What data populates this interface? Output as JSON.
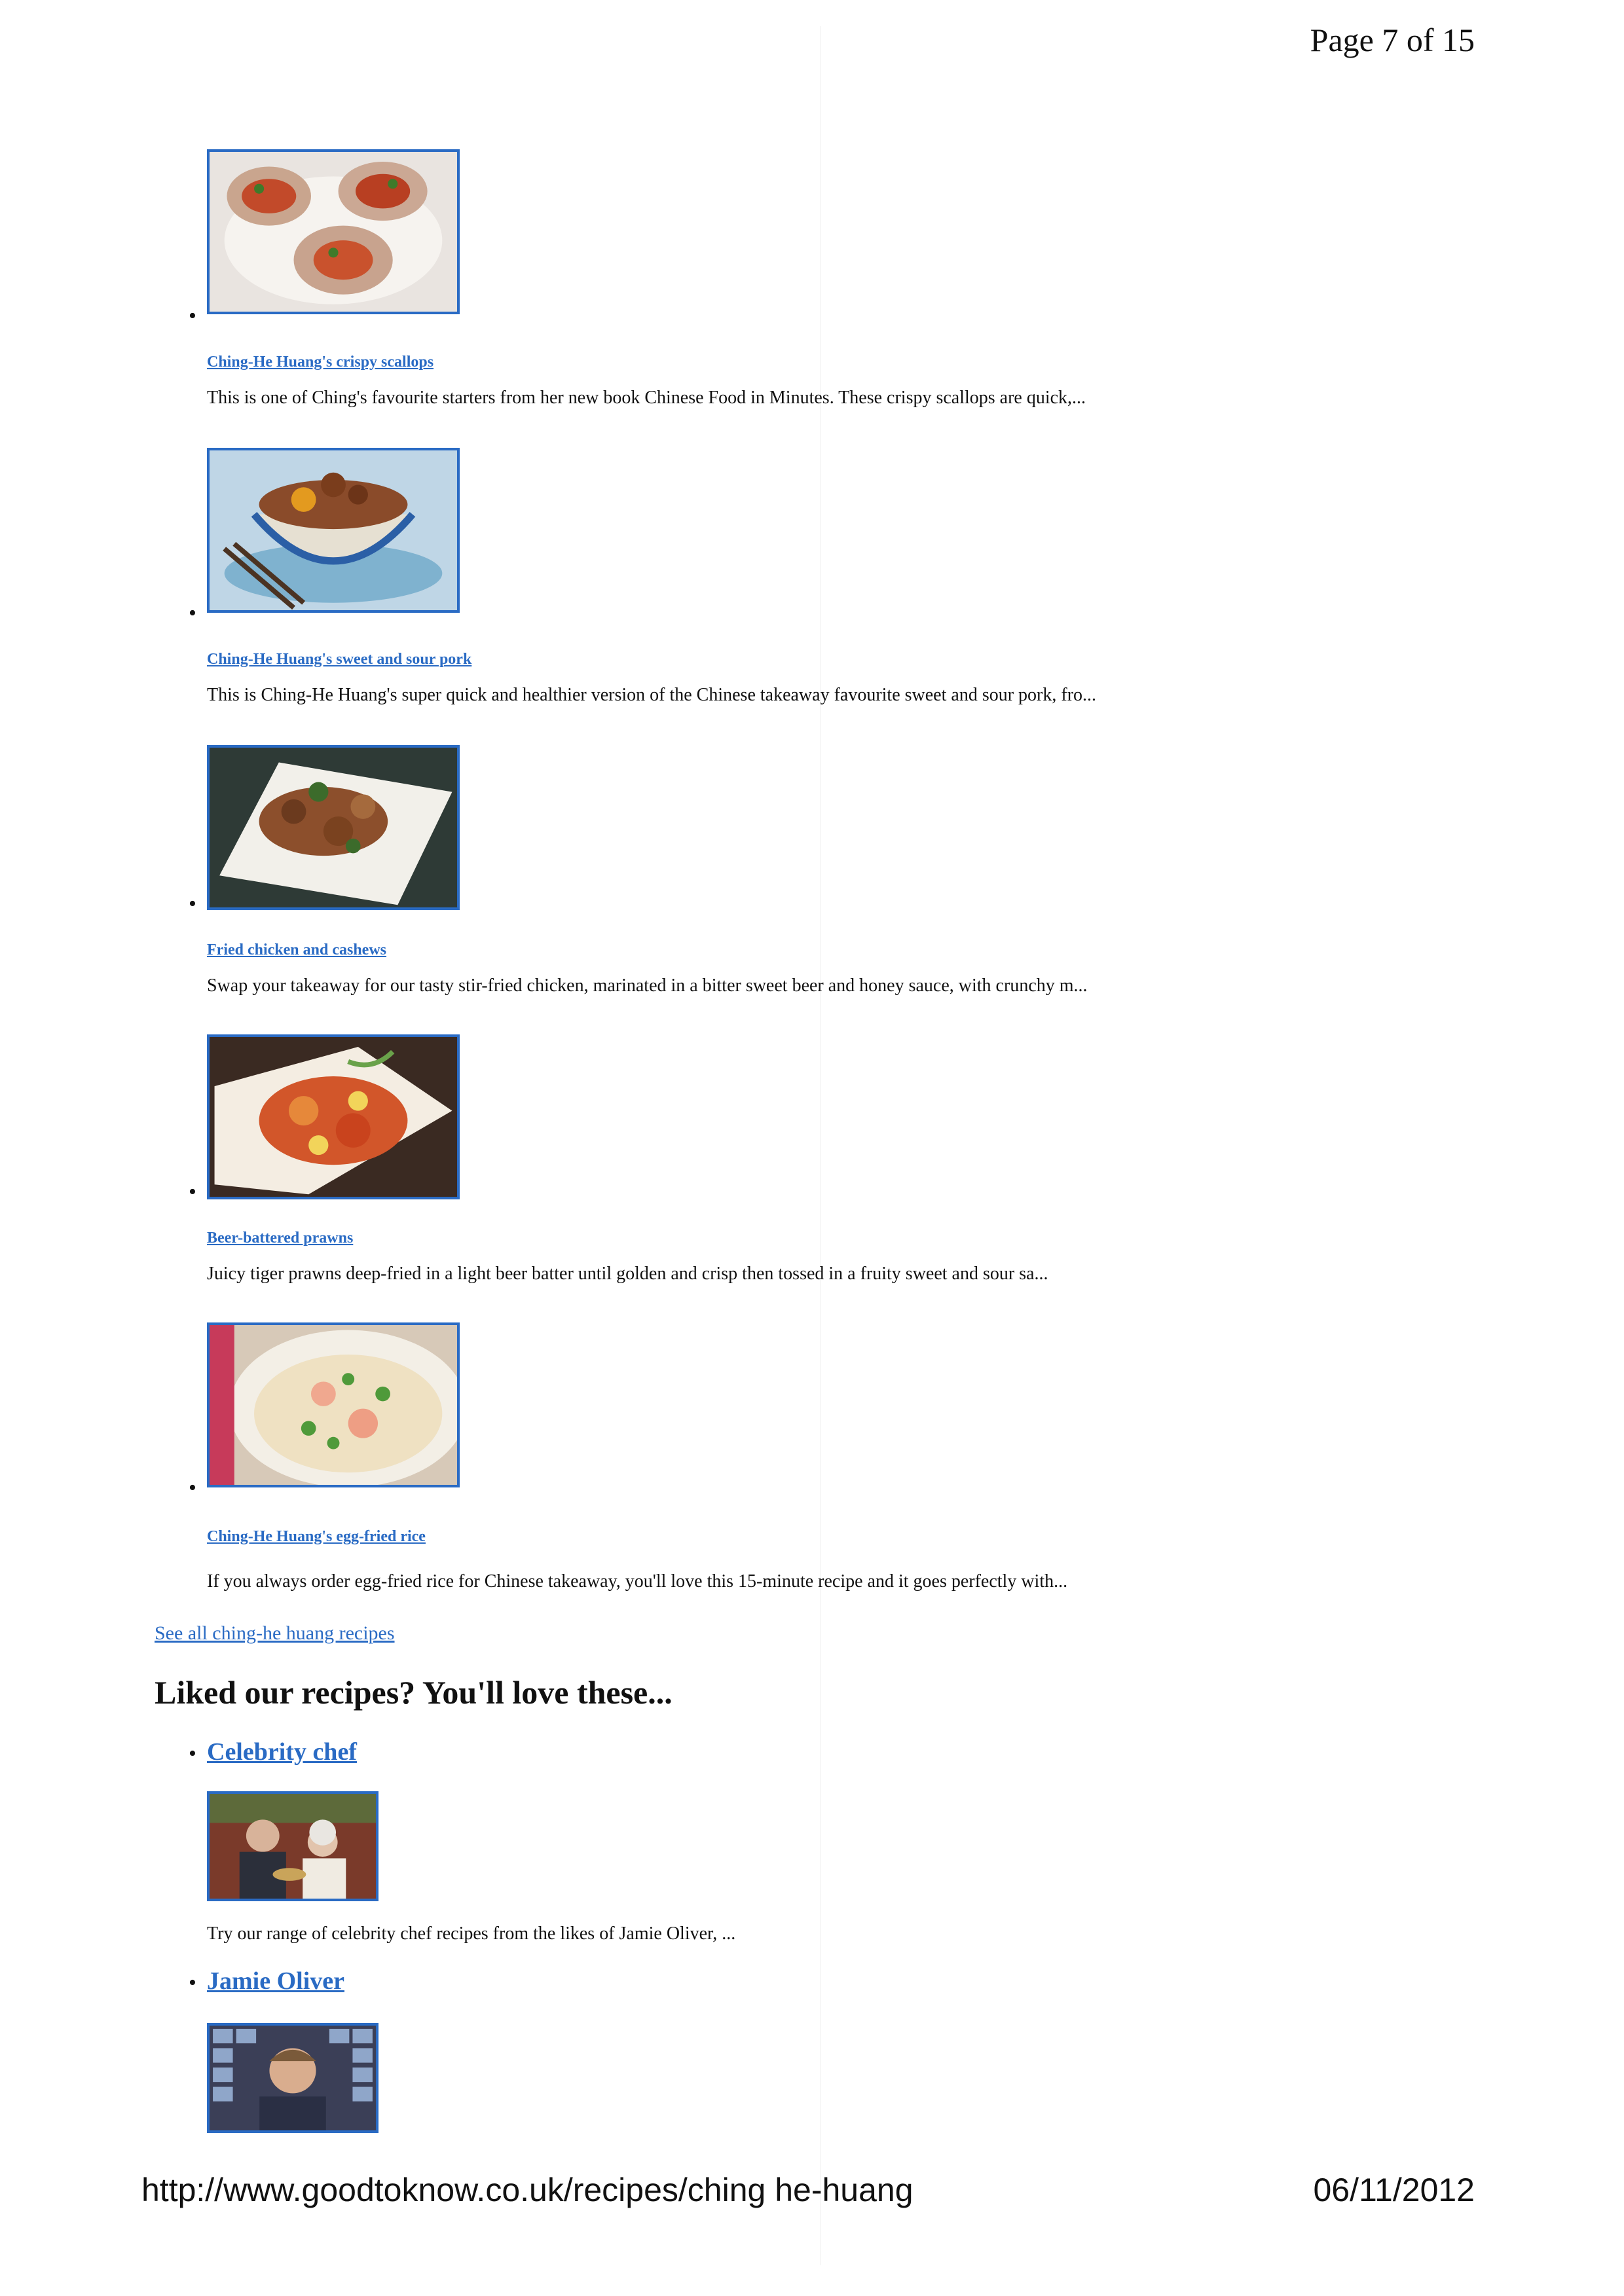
{
  "page_number": "Page 7 of 15",
  "recipes": [
    {
      "title": "Ching-He Huang's crispy scallops",
      "description": "This is one of Ching's favourite starters from her new book Chinese Food in Minutes. These crispy scallops are quick,...",
      "image": "scallops-photo"
    },
    {
      "title": "Ching-He Huang's sweet and sour pork",
      "description": "This is Ching-He Huang's super quick and healthier version of the Chinese takeaway favourite sweet and sour pork, fro...",
      "image": "sweet-sour-pork-photo"
    },
    {
      "title": "Fried chicken and cashews",
      "description": "Swap your takeaway for our tasty stir-fried chicken, marinated in a bitter sweet beer and honey sauce, with crunchy m...",
      "image": "chicken-cashews-photo"
    },
    {
      "title": "Beer-battered prawns",
      "description": "Juicy tiger prawns deep-fried in a light beer batter until golden and crisp then tossed in a fruity sweet and sour sa...",
      "image": "prawns-photo"
    },
    {
      "title": "Ching-He Huang's egg-fried rice",
      "description": "If you always order egg-fried rice for Chinese takeaway, you'll love this 15-minute recipe and it goes perfectly with...",
      "image": "egg-fried-rice-photo"
    }
  ],
  "see_all": "See all ching-he huang recipes",
  "liked_heading": "Liked our recipes? You'll love these...",
  "related": [
    {
      "label": "Celebrity chef",
      "description": "Try our range of celebrity chef recipes from the likes of Jamie Oliver, ...",
      "image": "celebrity-chefs-photo"
    },
    {
      "label": "Jamie Oliver",
      "description": "",
      "image": "jamie-oliver-photo"
    }
  ],
  "footer": {
    "url": "http://www.goodtoknow.co.uk/recipes/ching he-huang",
    "date": "06/11/2012"
  },
  "colors": {
    "link": "#2a6bc4",
    "text": "#111111",
    "background": "#ffffff"
  }
}
